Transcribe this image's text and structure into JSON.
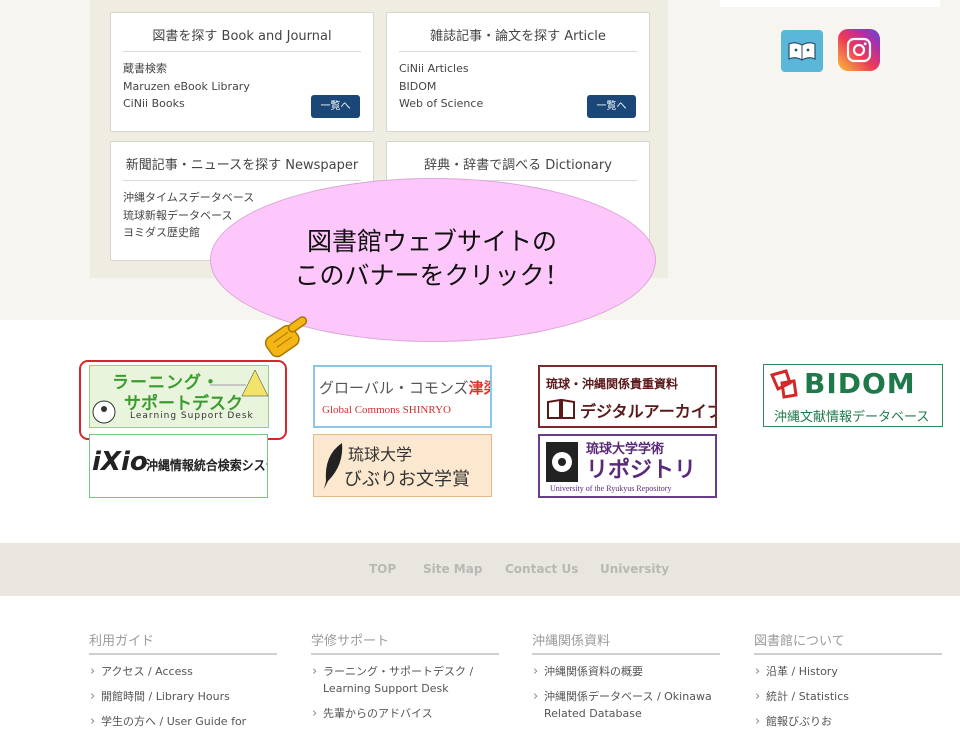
{
  "search_cards": [
    {
      "title": "図書を探す Book and Journal",
      "items": [
        "蔵書検索",
        "Maruzen eBook Library",
        "CiNii Books"
      ],
      "button": "一覧へ"
    },
    {
      "title": "雑誌記事・論文を探す Article",
      "items": [
        "CiNii Articles",
        "BIDOM",
        "Web of Science"
      ],
      "button": "一覧へ"
    },
    {
      "title": "新聞記事・ニュースを探す Newspaper",
      "items": [
        "沖縄タイムスデータベース",
        "琉球新報データベース",
        "ヨミダス歴史館"
      ]
    },
    {
      "title": "辞典・辞書で調べる Dictionary",
      "items": []
    }
  ],
  "callout": {
    "line1": "図書館ウェブサイトの",
    "line2": "このバナーをクリック！"
  },
  "banners": {
    "learning_support": {
      "line1": "ラーニング・",
      "line2": "サポートデスク",
      "sub": "Learning Support Desk"
    },
    "global_commons": {
      "line1a": "グローバル・コモンズ",
      "line1b": "津梁",
      "line2": "Global Commons SHINRYO"
    },
    "ryukyu_archive": {
      "line1": "琉球・沖縄関係貴重資料",
      "line2": "デジタルアーカイブ"
    },
    "bidom": {
      "line1": "BIDOM",
      "line2": "沖縄文献情報データベース"
    },
    "ixio": {
      "logo": "iXio",
      "text": "沖縄情報統合検索システム"
    },
    "biburio": {
      "line1": "琉球大学",
      "line2": "びぶりお文学賞"
    },
    "repository": {
      "line1": "琉球大学学術",
      "line2": "リポジトリ",
      "sub": "University of the Ryukyus Repository"
    }
  },
  "footer_nav": [
    "TOP",
    "Site Map",
    "Contact Us",
    "University"
  ],
  "footer_columns": [
    {
      "heading": "利用ガイド",
      "links": [
        "アクセス / Access",
        "開館時間 / Library Hours",
        "学生の方へ / User Guide for"
      ]
    },
    {
      "heading": "学修サポート",
      "links": [
        "ラーニング・サポートデスク / Learning Support Desk",
        "先輩からのアドバイス"
      ]
    },
    {
      "heading": "沖縄関係資料",
      "links": [
        "沖縄関係資料の概要",
        "沖縄関係データベース / Okinawa Related Database"
      ]
    },
    {
      "heading": "図書館について",
      "links": [
        "沿革 / History",
        "統計 / Statistics",
        "館報びぶりお"
      ]
    }
  ],
  "colors": {
    "button": "#1a4778",
    "bubble": "#fdc7fb",
    "highlight": "#d7262b",
    "beige": "#f7f5ef"
  },
  "icons": [
    "book-app-icon",
    "instagram-icon",
    "pointing-hand-icon"
  ]
}
